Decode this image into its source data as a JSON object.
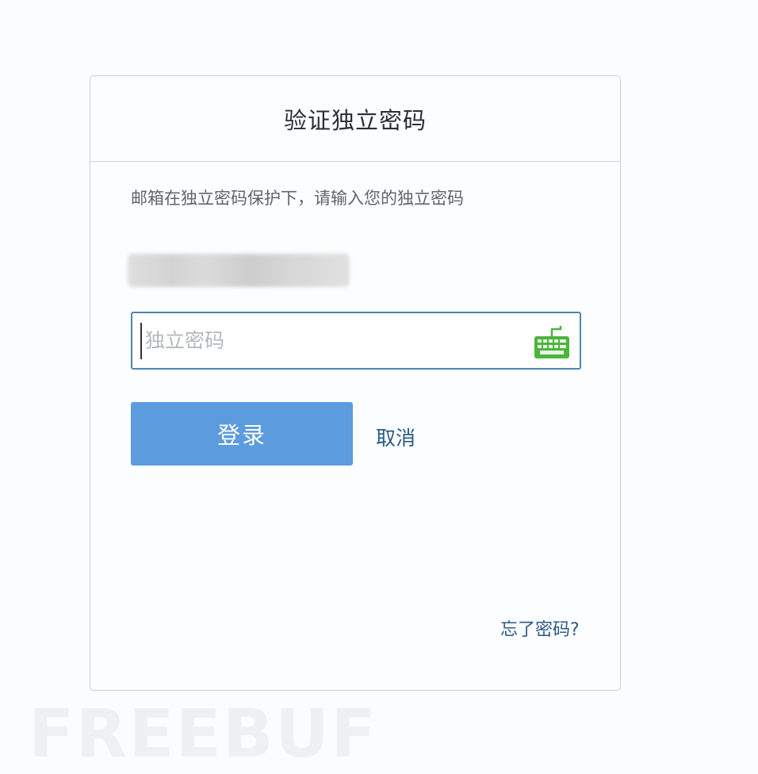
{
  "dialog": {
    "title": "验证独立密码",
    "prompt": "邮箱在独立密码保护下，请输入您的独立密码"
  },
  "password": {
    "placeholder": "独立密码",
    "value": "",
    "keyboard_icon": "keyboard-icon"
  },
  "actions": {
    "login_label": "登录",
    "cancel_label": "取消",
    "forgot_label": "忘了密码?"
  },
  "colors": {
    "primary_button": "#5b9bde",
    "link": "#2b5a86",
    "input_border": "#4d86b4",
    "keyboard_green": "#4bb53c"
  },
  "watermark": "FREEBUF"
}
